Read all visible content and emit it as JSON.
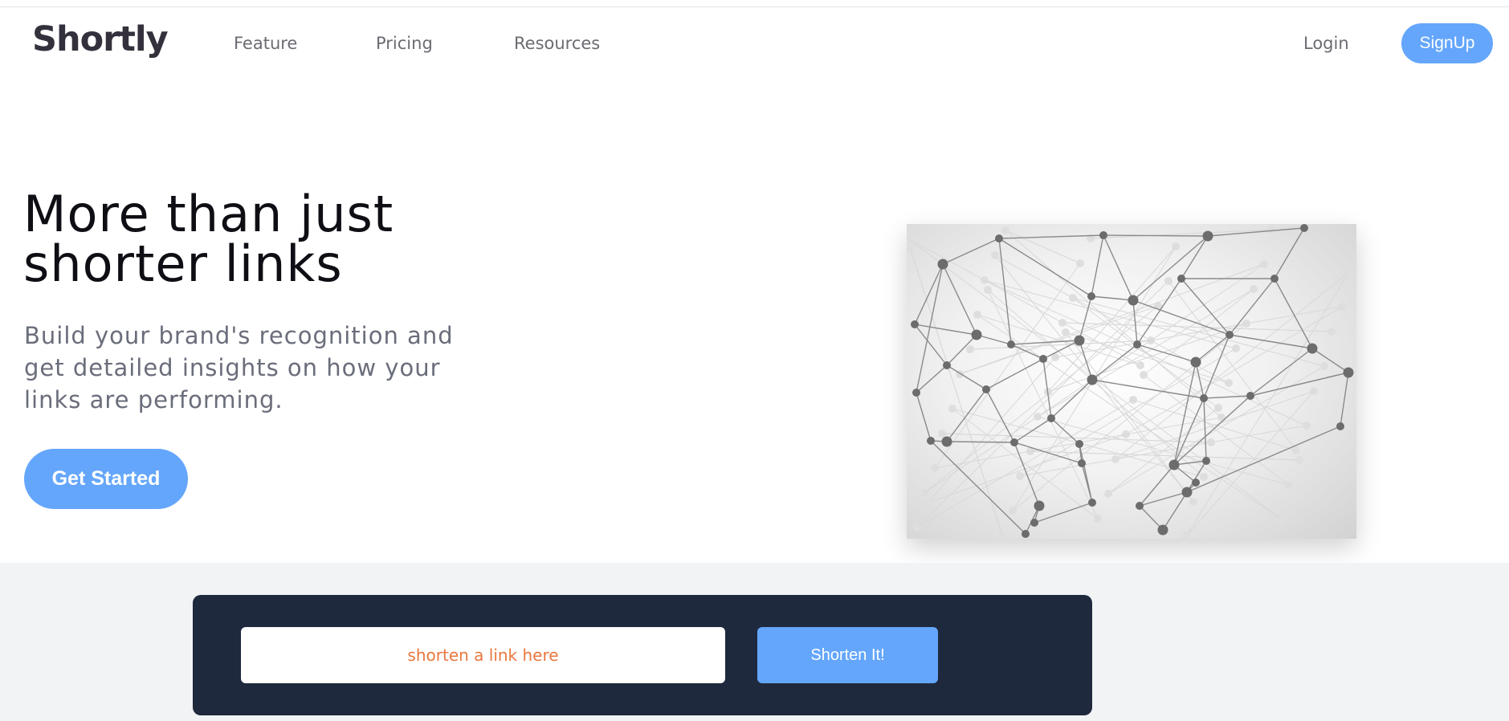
{
  "brand": {
    "logo_text": "Shortly"
  },
  "nav": {
    "links": [
      "Feature",
      "Pricing",
      "Resources"
    ],
    "login_label": "Login",
    "signup_label": "SignUp"
  },
  "hero": {
    "title_line1": "More than just",
    "title_line2": "shorter links",
    "subtitle": "Build your brand's recognition and get detailed insights on how your links are performing.",
    "cta_label": "Get Started",
    "image_icon": "network-illustration"
  },
  "shortener": {
    "input_value": "",
    "input_placeholder": "shorten a link here",
    "button_label": "Shorten It!"
  },
  "colors": {
    "accent": "#64a6fb",
    "dark_panel": "#1f293d",
    "band_bg": "#f2f3f5",
    "placeholder_text": "#e9773e",
    "logo_text": "#34313d"
  }
}
